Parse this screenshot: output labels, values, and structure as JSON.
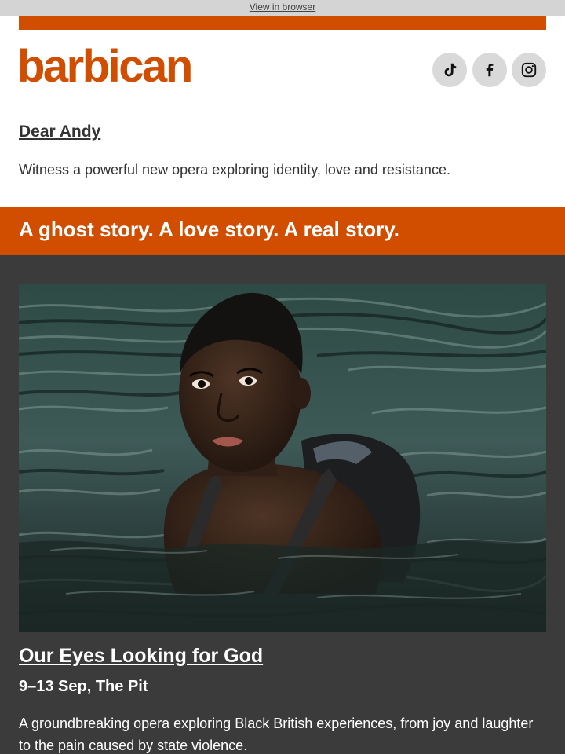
{
  "topbar": {
    "view_in_browser": "View in browser"
  },
  "brand": {
    "logo_text": "barbican",
    "accent_color": "#d14d00"
  },
  "social": [
    {
      "name": "tiktok-icon"
    },
    {
      "name": "facebook-icon"
    },
    {
      "name": "instagram-icon"
    }
  ],
  "greeting": "Dear Andy",
  "intro": "Witness a powerful new opera exploring identity, love and resistance.",
  "banner": {
    "headline": "A ghost story. A love story. A real story."
  },
  "event": {
    "title": "Our Eyes Looking for God",
    "date_venue": "9–13 Sep, The Pit",
    "description": "A groundbreaking opera exploring Black British experiences, from joy and laughter to the pain caused by state violence."
  }
}
